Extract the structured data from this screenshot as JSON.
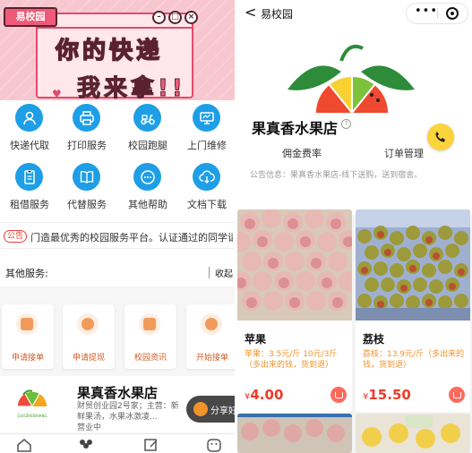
{
  "left": {
    "banner": {
      "badge": "易校园",
      "line1": "你的快递",
      "line2": "我来拿!!"
    },
    "services": [
      {
        "label": "快递代取",
        "icon": "user-icon"
      },
      {
        "label": "打印服务",
        "icon": "printer-icon"
      },
      {
        "label": "校园跑腿",
        "icon": "scooter-icon"
      },
      {
        "label": "上门维修",
        "icon": "monitor-icon"
      },
      {
        "label": "租借服务",
        "icon": "document-icon"
      },
      {
        "label": "代替服务",
        "icon": "book-icon"
      },
      {
        "label": "其他帮助",
        "icon": "chat-icon"
      },
      {
        "label": "文档下载",
        "icon": "cloud-download-icon"
      }
    ],
    "notice": {
      "tag": "公告",
      "text": "门造最优秀的校园服务平台。认证通过的同学请..."
    },
    "other": {
      "title": "其他服务:",
      "collapse": "收起",
      "cards": [
        {
          "label": "申请接单"
        },
        {
          "label": "申请提现"
        },
        {
          "label": "校园资讯"
        },
        {
          "label": "开始接单"
        }
      ]
    },
    "shop": {
      "name": "果真香水果店",
      "desc": "财贸创业园2号家；主营：新鲜果汤，水果冰激凌...",
      "desc2": "营业中",
      "logo_text": "GUOZHENXIANG"
    },
    "share": {
      "label": "分享好"
    }
  },
  "right": {
    "nav": {
      "back": "<",
      "title": "易校园",
      "more": "•••"
    },
    "shop": {
      "name": "果真香水果店",
      "info": "?",
      "links": [
        "佣金费率",
        "订单管理"
      ],
      "notice": "公告信息：果真香水果店-线下送购，送到宿舍。"
    },
    "products": [
      {
        "name": "苹果",
        "desc": "苹果：3.5元/斤 10元/3斤（多出来的钱，货到退）",
        "currency": "¥",
        "price": "4.00"
      },
      {
        "name": "荔枝",
        "desc": "荔枝：13.9元/斤（多出来的钱，货到退）",
        "currency": "¥",
        "price": "15.50"
      }
    ]
  },
  "colors": {
    "accent_blue": "#1e9ee6",
    "price_red": "#ee3b2b",
    "banner_pink": "#f7c6cf",
    "orange": "#f0932b",
    "yellow": "#fbd33a"
  }
}
